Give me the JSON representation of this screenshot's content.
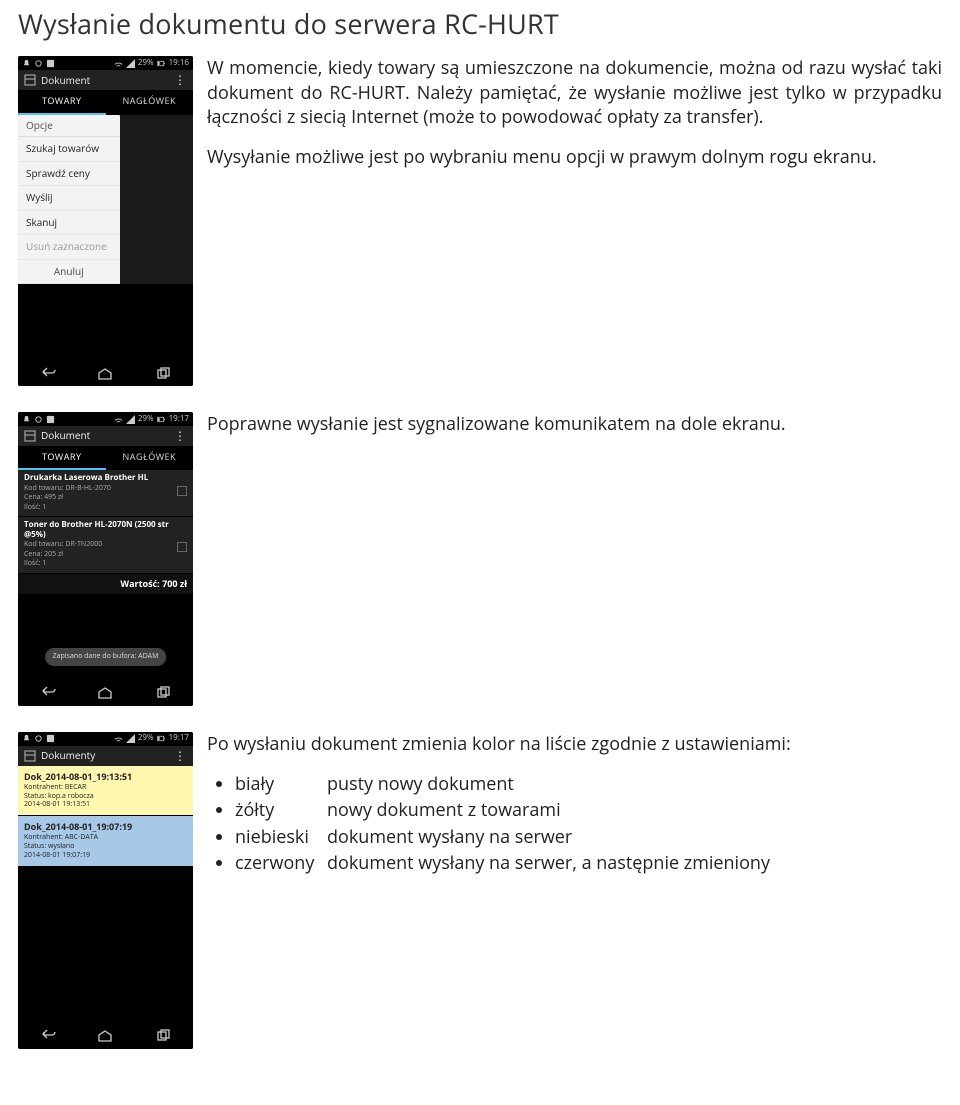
{
  "heading": "Wysłanie dokumentu do serwera RC-HURT",
  "para1": "W momencie, kiedy towary są umieszczone na dokumencie, można od razu wysłać taki dokument do RC-HURT. Należy pamiętać, że wysłanie możliwe jest tylko w przypadku łączności z siecią Internet (może to powodować opłaty za transfer).",
  "para2": " Wysyłanie możliwe jest po wybraniu menu opcji w prawym dolnym rogu ekranu.",
  "para3": "Poprawne wysłanie jest sygnalizowane komunikatem na dole ekranu.",
  "para4": "Po wysłaniu dokument zmienia kolor na liście zgodnie z ustawieniami:",
  "status": {
    "signal": "29%",
    "time1": "19:16",
    "time2": "19:17",
    "time3": "19:17"
  },
  "appbar": {
    "title_dokument": "Dokument",
    "title_dokumenty": "Dokumenty"
  },
  "tabs": {
    "tab1": "TOWARY",
    "tab2": "NAGŁÓWEK"
  },
  "popup": {
    "title": "Opcje",
    "items": [
      "Szukaj towarów",
      "Sprawdź ceny",
      "Wyślij",
      "Skanuj",
      "Usuń zaznaczone",
      "Anuluj"
    ]
  },
  "products": [
    {
      "name": "Drukarka Laserowa Brother HL",
      "code": "Kod towaru: DR-B-HL-2070",
      "price": "Cena: 495 zł",
      "qty": "Ilość: 1"
    },
    {
      "name": "Toner do Brother HL-2070N (2500 str @5%)",
      "code": "Kod towaru: DR-TN2000",
      "price": "Cena: 205 zł",
      "qty": "Ilość: 1"
    }
  ],
  "total": "Wartość: 700 zł",
  "toast": "Zapisano dane do bufora: ADAM",
  "docs": [
    {
      "title": "Dok_2014-08-01_19:13:51",
      "k": "Kontrahent: BECAR",
      "s": "Status: kop.a robocza",
      "d": "2014-08-01 19:13:51"
    },
    {
      "title": "Dok_2014-08-01_19:07:19",
      "k": "Kontrahent: ABC-DATA",
      "s": "Status: wysłano",
      "d": "2014-08-01 19:07:19"
    }
  ],
  "legend": [
    {
      "color": "biały",
      "desc": "pusty nowy dokument"
    },
    {
      "color": "żółty",
      "desc": "nowy dokument z towarami"
    },
    {
      "color": "niebieski",
      "desc": "dokument wysłany na serwer"
    },
    {
      "color": "czerwony",
      "desc": "dokument wysłany na serwer, a następnie zmieniony"
    }
  ]
}
